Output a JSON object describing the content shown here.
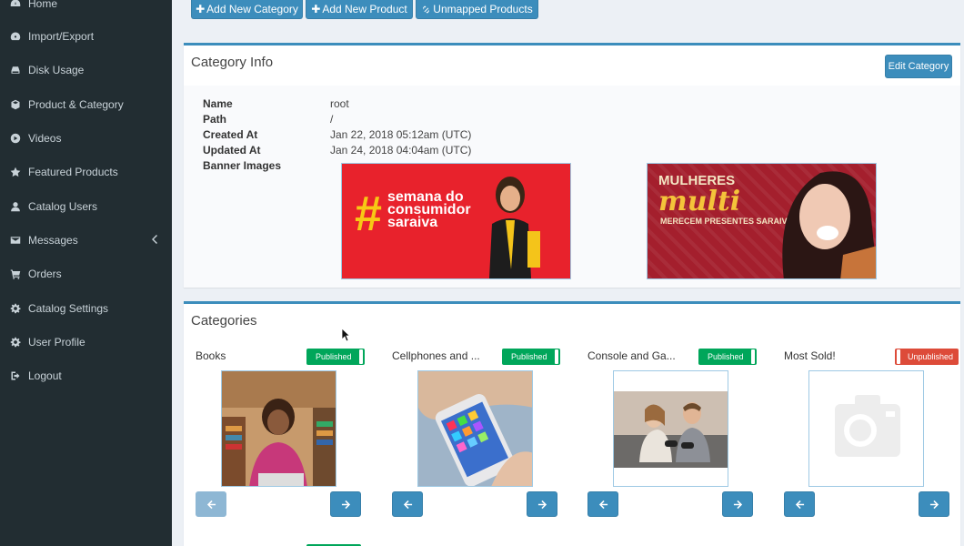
{
  "sidebar": {
    "items": [
      {
        "label": "Home",
        "icon": "dashboard-icon"
      },
      {
        "label": "Import/Export",
        "icon": "tachometer-icon"
      },
      {
        "label": "Disk Usage",
        "icon": "hdd-icon"
      },
      {
        "label": "Product & Category",
        "icon": "cube-icon"
      },
      {
        "label": "Videos",
        "icon": "play-circle-icon"
      },
      {
        "label": "Featured Products",
        "icon": "star-icon"
      },
      {
        "label": "Catalog Users",
        "icon": "user-icon"
      },
      {
        "label": "Messages",
        "icon": "envelope-icon"
      },
      {
        "label": "Orders",
        "icon": "cart-icon"
      },
      {
        "label": "Catalog Settings",
        "icon": "gear-icon"
      },
      {
        "label": "User Profile",
        "icon": "gear-icon"
      },
      {
        "label": "Logout",
        "icon": "sign-out-icon"
      }
    ]
  },
  "toolbar": {
    "add_category": "Add New Category",
    "add_product": "Add New Product",
    "unmapped": "Unmapped Products"
  },
  "category_info": {
    "title": "Category Info",
    "edit_label": "Edit Category",
    "fields": [
      {
        "label": "Name",
        "value": "root"
      },
      {
        "label": "Path",
        "value": "/"
      },
      {
        "label": "Created At",
        "value": "Jan 22, 2018 05:12am (UTC)"
      },
      {
        "label": "Updated At",
        "value": "Jan 24, 2018 04:04am (UTC)"
      },
      {
        "label": "Banner Images",
        "value": ""
      }
    ],
    "banners": [
      {
        "hash": "#",
        "lines": [
          "semana do",
          "consumidor",
          "saraiva"
        ]
      },
      {
        "line1": "MULHERES",
        "line2": "multi",
        "line3": "MERECEM PRESENTES SARAIVA"
      }
    ]
  },
  "categories": {
    "title": "Categories",
    "items": [
      {
        "name": "Books",
        "status": "Published"
      },
      {
        "name": "Cellphones and ...",
        "status": "Published"
      },
      {
        "name": "Console and Ga...",
        "status": "Published"
      },
      {
        "name": "Most Sold!",
        "status": "Unpublished"
      }
    ]
  },
  "colors": {
    "sidebar_bg": "#222d32",
    "primary": "#3c8dbc",
    "published": "#00a65a",
    "unpublished": "#dd4b39",
    "page_bg": "#ecf0f5"
  }
}
